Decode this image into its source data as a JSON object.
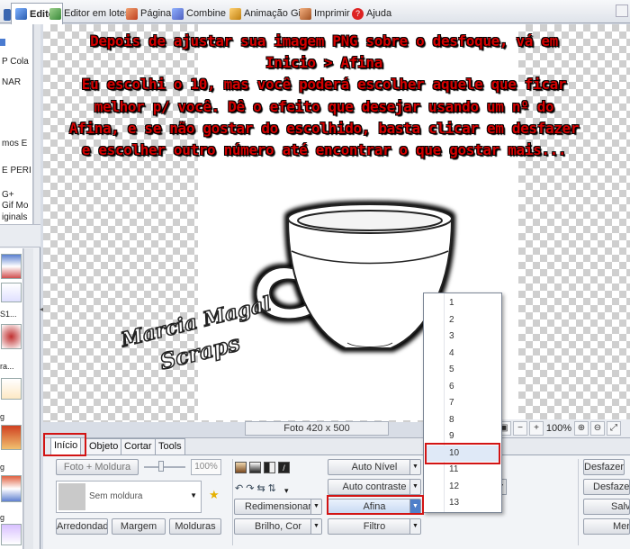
{
  "top_tabs": [
    {
      "label": "Editor",
      "active": true
    },
    {
      "label": "Editor em lotes"
    },
    {
      "label": "Página"
    },
    {
      "label": "Combine"
    },
    {
      "label": "Animação Gif"
    },
    {
      "label": "Imprimir"
    },
    {
      "label": "Ajuda"
    }
  ],
  "sidebar": {
    "text_fragments": [
      "P Cola",
      "NAR",
      "mos E",
      "E PERI",
      "G+",
      "Gif Mo",
      "iginals",
      "S1...",
      "ra...",
      "g",
      "g",
      "g"
    ]
  },
  "instructions": [
    "Depois de ajustar sua imagem PNG sobre o desfoque, vá em",
    "Inicio > Afina",
    "Eu escolhi o 10, mas você poderá escolher aquele que ficar",
    "melhor p/ você. Dê o efeito que desejar usando um nº do",
    "Afina, e se não gostar do escolhido, basta clicar em desfazer",
    "e escolher outro número até encontrar o que gostar mais..."
  ],
  "watermark": {
    "line1": "Marcia Magal",
    "line2": "Scraps"
  },
  "status": {
    "photo_size": "Foto 420 x 500"
  },
  "zoom": {
    "value": "100%"
  },
  "panel": {
    "tabs": [
      "Início",
      "Objeto",
      "Cortar",
      "Tools"
    ],
    "active_tab": "Início",
    "frame_button": "Foto + Moldura",
    "slider_percent": "100%",
    "frame_select": "Sem moldura",
    "buttons": {
      "rounded": "Arredondado",
      "margin": "Margem",
      "frames": "Molduras",
      "resize": "Redimensionar",
      "brightness": "Brilho, Cor",
      "auto_level": "Auto Nível",
      "auto_contrast": "Auto contraste",
      "sharpen": "Afina",
      "filter": "Filtro",
      "undo": "Desfazer",
      "undo_all": "Desfazer",
      "save": "Salv",
      "more": "Mer"
    }
  },
  "sharpen_menu": {
    "items": [
      "1",
      "2",
      "3",
      "4",
      "5",
      "6",
      "7",
      "8",
      "9",
      "10",
      "11",
      "12",
      "13"
    ],
    "selected": "10"
  },
  "colors": {
    "instruction_text": "#d40000",
    "highlight": "#d21414",
    "selected_item_bg": "#dfe9f7"
  }
}
